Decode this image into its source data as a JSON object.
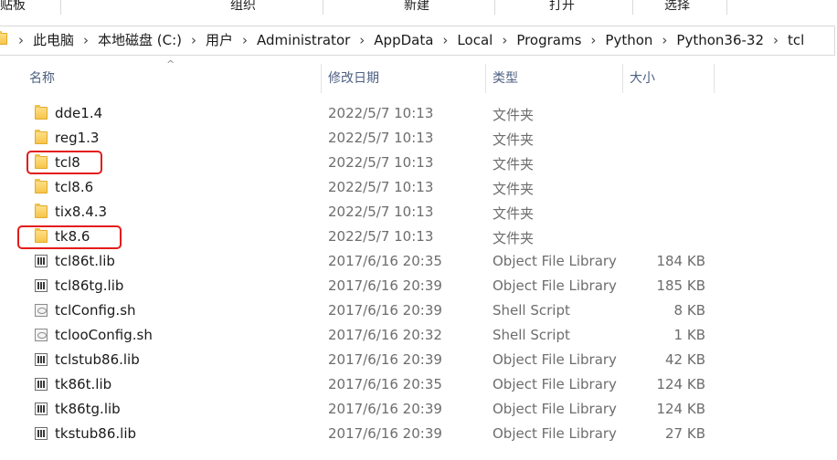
{
  "ribbon": {
    "groups": [
      "贴板",
      "组织",
      "新建",
      "打开",
      "选择"
    ]
  },
  "address": {
    "crumbs": [
      "此电脑",
      "本地磁盘 (C:)",
      "用户",
      "Administrator",
      "AppData",
      "Local",
      "Programs",
      "Python",
      "Python36-32",
      "tcl"
    ],
    "separator": "›"
  },
  "columns": {
    "name": "名称",
    "date": "修改日期",
    "type": "类型",
    "size": "大小",
    "sort_indicator": "^"
  },
  "files": [
    {
      "name": "dde1.4",
      "date": "2022/5/7 10:13",
      "type": "文件夹",
      "size": "",
      "icon": "folder-icon"
    },
    {
      "name": "reg1.3",
      "date": "2022/5/7 10:13",
      "type": "文件夹",
      "size": "",
      "icon": "folder-icon"
    },
    {
      "name": "tcl8",
      "date": "2022/5/7 10:13",
      "type": "文件夹",
      "size": "",
      "icon": "folder-icon"
    },
    {
      "name": "tcl8.6",
      "date": "2022/5/7 10:13",
      "type": "文件夹",
      "size": "",
      "icon": "folder-icon"
    },
    {
      "name": "tix8.4.3",
      "date": "2022/5/7 10:13",
      "type": "文件夹",
      "size": "",
      "icon": "folder-icon"
    },
    {
      "name": "tk8.6",
      "date": "2022/5/7 10:13",
      "type": "文件夹",
      "size": "",
      "icon": "folder-icon"
    },
    {
      "name": "tcl86t.lib",
      "date": "2017/6/16 20:35",
      "type": "Object File Library",
      "size": "184 KB",
      "icon": "library-file-icon"
    },
    {
      "name": "tcl86tg.lib",
      "date": "2017/6/16 20:39",
      "type": "Object File Library",
      "size": "185 KB",
      "icon": "library-file-icon"
    },
    {
      "name": "tclConfig.sh",
      "date": "2017/6/16 20:39",
      "type": "Shell Script",
      "size": "8 KB",
      "icon": "script-file-icon"
    },
    {
      "name": "tclooConfig.sh",
      "date": "2017/6/16 20:32",
      "type": "Shell Script",
      "size": "1 KB",
      "icon": "script-file-icon"
    },
    {
      "name": "tclstub86.lib",
      "date": "2017/6/16 20:39",
      "type": "Object File Library",
      "size": "42 KB",
      "icon": "library-file-icon"
    },
    {
      "name": "tk86t.lib",
      "date": "2017/6/16 20:35",
      "type": "Object File Library",
      "size": "124 KB",
      "icon": "library-file-icon"
    },
    {
      "name": "tk86tg.lib",
      "date": "2017/6/16 20:39",
      "type": "Object File Library",
      "size": "124 KB",
      "icon": "library-file-icon"
    },
    {
      "name": "tkstub86.lib",
      "date": "2017/6/16 20:39",
      "type": "Object File Library",
      "size": "27 KB",
      "icon": "library-file-icon"
    }
  ],
  "highlights": [
    "tcl8",
    "tk8.6"
  ],
  "colors": {
    "highlight": "#e31b1b",
    "header_text": "#4d6082",
    "folder": "#f5c447"
  }
}
